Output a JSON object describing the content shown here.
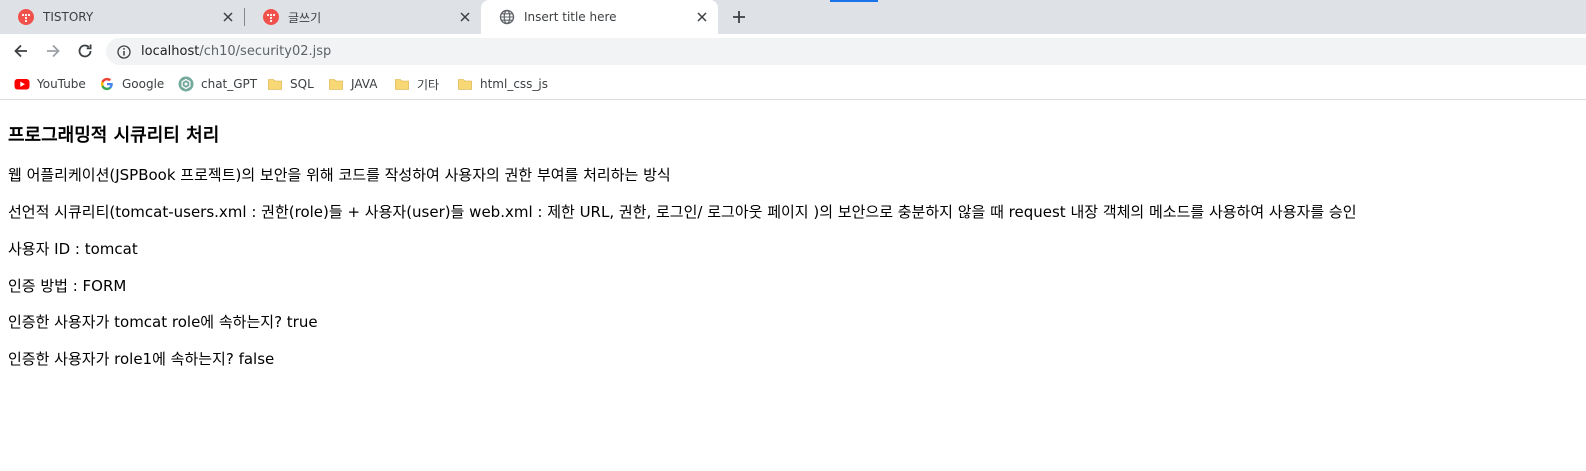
{
  "browser": {
    "tabs": [
      {
        "title": "TISTORY",
        "favicon": "tistory-icon",
        "active": false
      },
      {
        "title": "글쓰기",
        "favicon": "tistory-icon",
        "active": false
      },
      {
        "title": "Insert title here",
        "favicon": "globe-icon",
        "active": true
      }
    ],
    "address": {
      "host": "localhost",
      "path": "/ch10/security02.jsp"
    },
    "bookmarks": [
      {
        "label": "YouTube",
        "icon": "youtube-icon"
      },
      {
        "label": "Google",
        "icon": "google-icon"
      },
      {
        "label": "chat_GPT",
        "icon": "chatgpt-icon"
      },
      {
        "label": "SQL",
        "icon": "folder-icon"
      },
      {
        "label": "JAVA",
        "icon": "folder-icon"
      },
      {
        "label": "기타",
        "icon": "folder-icon"
      },
      {
        "label": "html_css_js",
        "icon": "folder-icon"
      }
    ]
  },
  "page": {
    "heading": "프로그래밍적 시큐리티 처리",
    "paragraphs": [
      "웹 어플리케이션(JSPBook 프로젝트)의 보안을 위해 코드를 작성하여 사용자의 권한 부여를 처리하는 방식",
      "선언적 시큐리티(tomcat-users.xml : 권한(role)들 + 사용자(user)들 web.xml : 제한 URL, 권한, 로그인/ 로그아웃 페이지 )의 보안으로 충분하지 않을 때 request 내장 객체의 메소드를 사용하여 사용자를 승인",
      "사용자 ID : tomcat",
      "인증 방법 : FORM",
      "인증한 사용자가 tomcat role에 속하는지? true",
      "인증한 사용자가 role1에 속하는지? false"
    ]
  },
  "colors": {
    "tabstrip": "#dee1e6",
    "tistory": "#f0524b",
    "youtube": "#ff0000",
    "folder": "#f8d775",
    "accent": "#1a73e8"
  }
}
